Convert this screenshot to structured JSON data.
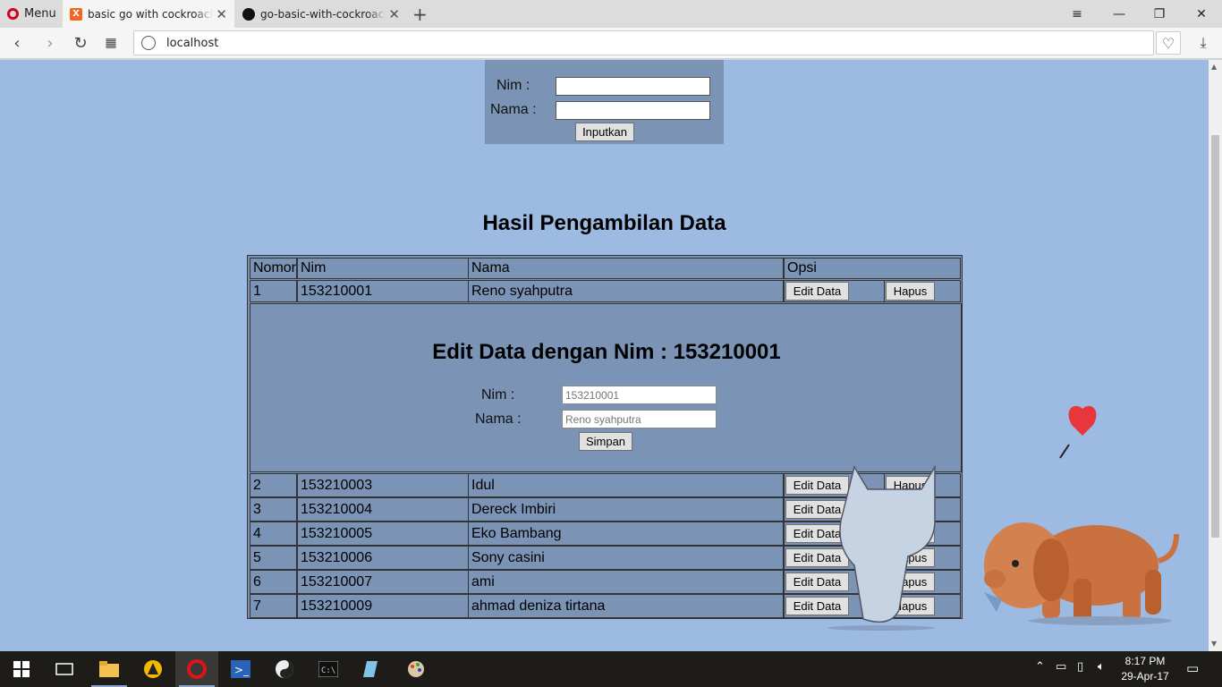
{
  "browser": {
    "menu_label": "Menu",
    "tabs": [
      {
        "title": "basic go with cockroachDB",
        "active": true
      },
      {
        "title": "go-basic-with-cockroachDB",
        "active": false
      }
    ],
    "url": "localhost"
  },
  "input_form": {
    "nim_label": "Nim :",
    "nama_label": "Nama :",
    "nim_value": "",
    "nama_value": "",
    "submit_label": "Inputkan"
  },
  "results": {
    "title": "Hasil Pengambilan Data",
    "columns": [
      "Nomor",
      "Nim",
      "Nama",
      "Opsi"
    ],
    "edit_label": "Edit Data",
    "delete_label": "Hapus",
    "rows": [
      {
        "no": "1",
        "nim": "153210001",
        "nama": "Reno syahputra"
      },
      {
        "no": "2",
        "nim": "153210003",
        "nama": "Idul"
      },
      {
        "no": "3",
        "nim": "153210004",
        "nama": "Dereck Imbiri"
      },
      {
        "no": "4",
        "nim": "153210005",
        "nama": "Eko Bambang"
      },
      {
        "no": "5",
        "nim": "153210006",
        "nama": "Sony casini"
      },
      {
        "no": "6",
        "nim": "153210007",
        "nama": "ami"
      },
      {
        "no": "7",
        "nim": "153210009",
        "nama": "ahmad deniza tirtana"
      }
    ]
  },
  "edit_form": {
    "title": "Edit Data dengan Nim : 153210001",
    "nim_label": "Nim :",
    "nama_label": "Nama :",
    "nim_placeholder": "153210001",
    "nama_placeholder": "Reno syahputra",
    "save_label": "Simpan"
  },
  "taskbar": {
    "time": "8:17 PM",
    "date": "29-Apr-17"
  },
  "colors": {
    "page_bg": "#9dbae3",
    "panel_bg": "#7b93b5",
    "taskbar_bg": "#1e1c19"
  }
}
